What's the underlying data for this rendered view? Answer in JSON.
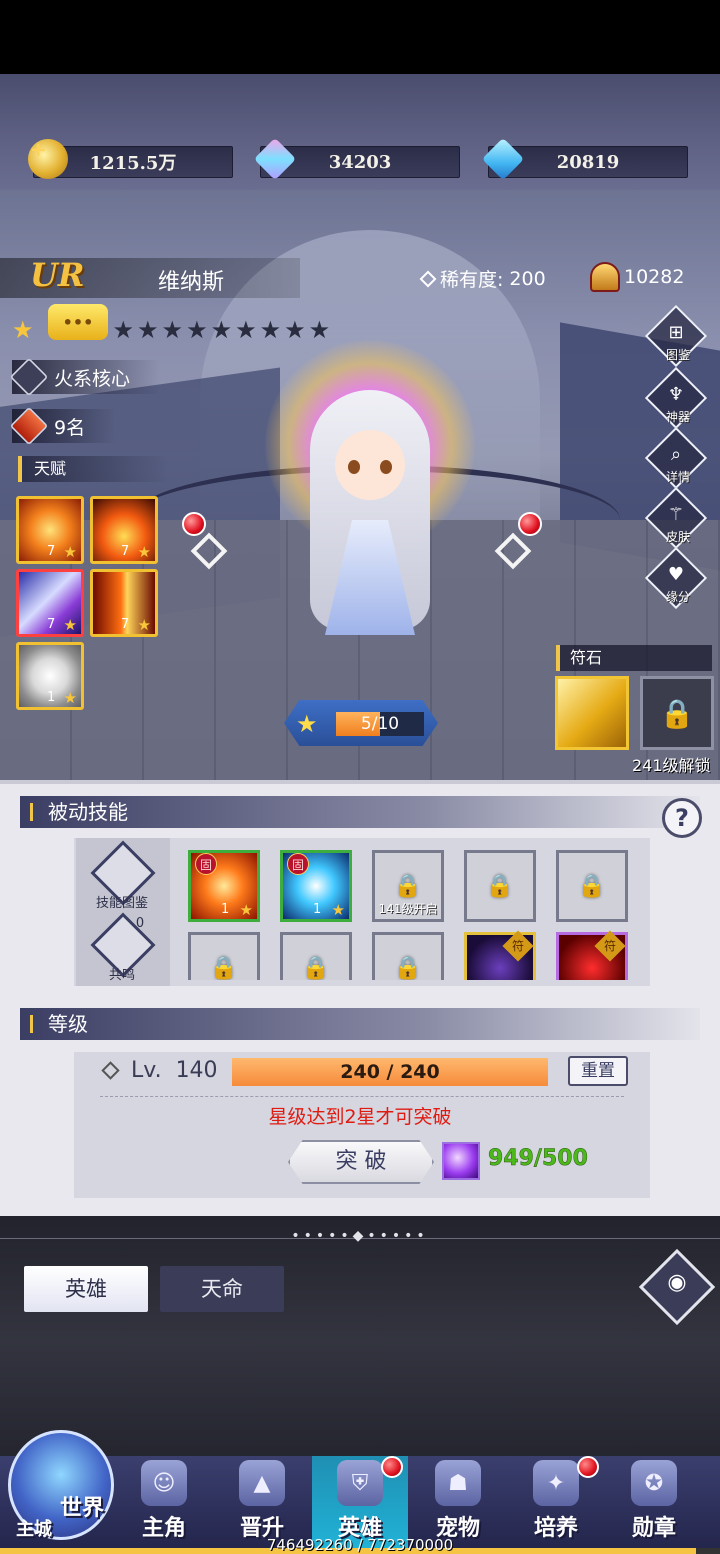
{
  "currencies": [
    {
      "name": "gold",
      "value": "1215.5万",
      "icon": "gold-coin-icon"
    },
    {
      "name": "rainbow-gem",
      "value": "34203",
      "icon": "rainbow-gem-icon"
    },
    {
      "name": "diamond",
      "value": "20819",
      "icon": "diamond-icon"
    }
  ],
  "hero": {
    "grade": "UR",
    "name": "维纳斯",
    "rarity_label": "稀有度:",
    "rarity_value": "200",
    "power": "10282",
    "stars_filled": 1,
    "stars_total": 10,
    "bubble": "•••",
    "element": "火系核心",
    "rank": "9名"
  },
  "talent": {
    "label": "天赋",
    "items": [
      {
        "level": "7",
        "icon": "fire-orb-icon"
      },
      {
        "level": "7",
        "icon": "flame-icon"
      },
      {
        "level": "7",
        "icon": "wind-slash-icon"
      },
      {
        "level": "7",
        "icon": "fire-pillar-icon"
      },
      {
        "level": "1",
        "icon": "light-burst-icon"
      }
    ]
  },
  "side_menu": [
    {
      "label": "图鉴",
      "icon": "codex-icon"
    },
    {
      "label": "神器",
      "icon": "artifact-icon"
    },
    {
      "label": "详情",
      "icon": "details-icon"
    },
    {
      "label": "皮肤",
      "icon": "skin-icon"
    },
    {
      "label": "缘分",
      "icon": "bond-icon"
    }
  ],
  "rune": {
    "label": "符石",
    "unlock_text": "241级解锁"
  },
  "star_progress": {
    "text": "5/10",
    "value": 5,
    "max": 10
  },
  "passive": {
    "title": "被动技能",
    "help": "?",
    "codex_label": "技能图鉴",
    "resonance_label": "共鸣",
    "resonance_count": "0",
    "slots_row1": [
      {
        "type": "fire",
        "level": "1",
        "tag": "固"
      },
      {
        "type": "blue",
        "level": "1",
        "tag": "固"
      },
      {
        "type": "locked",
        "caption": "141级开启"
      },
      {
        "type": "locked",
        "caption": ""
      },
      {
        "type": "locked",
        "caption": ""
      }
    ],
    "slots_row2": [
      {
        "type": "locked"
      },
      {
        "type": "locked"
      },
      {
        "type": "locked"
      },
      {
        "type": "dark",
        "tag": "符"
      },
      {
        "type": "red",
        "tag": "符"
      }
    ]
  },
  "level": {
    "title": "等级",
    "lv_prefix": "Lv.",
    "lv_value": "140",
    "exp_text": "240 / 240",
    "exp_fraction": 1.0,
    "reset_label": "重置",
    "hint": "星级达到2星才可突破",
    "break_label": "突 破",
    "cost_text": "949/500"
  },
  "tabs": {
    "hero": "英雄",
    "destiny": "天命"
  },
  "nav": {
    "world": "世界",
    "city": "主城",
    "items": [
      {
        "label": "主角",
        "icon": "protagonist-icon",
        "dot": false
      },
      {
        "label": "晋升",
        "icon": "promotion-icon",
        "dot": false
      },
      {
        "label": "英雄",
        "icon": "hero-helmet-icon",
        "dot": true
      },
      {
        "label": "宠物",
        "icon": "pet-icon",
        "dot": false
      },
      {
        "label": "培养",
        "icon": "train-icon",
        "dot": true
      },
      {
        "label": "勋章",
        "icon": "medal-icon",
        "dot": false
      }
    ]
  },
  "footer_exp": {
    "text": "746492260 / 772370000",
    "fraction": 0.966
  }
}
